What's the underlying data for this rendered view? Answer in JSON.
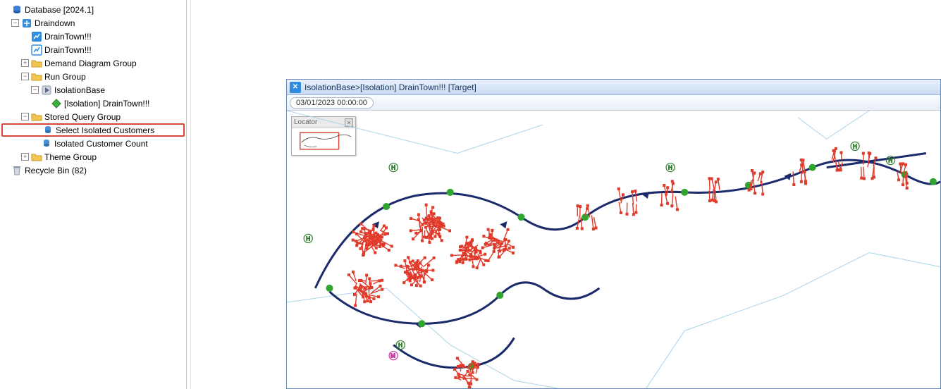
{
  "tree": {
    "root": {
      "label": "Database [2024.1]"
    },
    "draindown": {
      "label": "Draindown"
    },
    "draintown1": {
      "label": "DrainTown!!!"
    },
    "draintown2": {
      "label": "DrainTown!!!"
    },
    "demand_group": {
      "label": "Demand Diagram Group"
    },
    "run_group": {
      "label": "Run Group"
    },
    "isolation_base": {
      "label": "IsolationBase"
    },
    "isolation_draintown": {
      "label": "[Isolation] DrainTown!!!"
    },
    "stored_query_group": {
      "label": "Stored Query Group"
    },
    "select_isolated": {
      "label": "Select Isolated Customers"
    },
    "isolated_count": {
      "label": "Isolated Customer Count"
    },
    "theme_group": {
      "label": "Theme Group"
    },
    "recycle_bin": {
      "label": "Recycle Bin (82)"
    }
  },
  "map": {
    "title": "IsolationBase>[Isolation] DrainTown!!!  [Target]",
    "datetime": "03/01/2023 00:00:00",
    "locator_label": "Locator"
  },
  "symbols": {
    "plus": "+",
    "minus": "−",
    "close": "×"
  },
  "colors": {
    "pipe_dark": "#1b2a6b",
    "pipe_light": "#a8d3ea",
    "node_green": "#2fa52f",
    "node_red": "#e03a2a",
    "hydrant": "#2d7f2d",
    "highlight": "#d9463a"
  }
}
